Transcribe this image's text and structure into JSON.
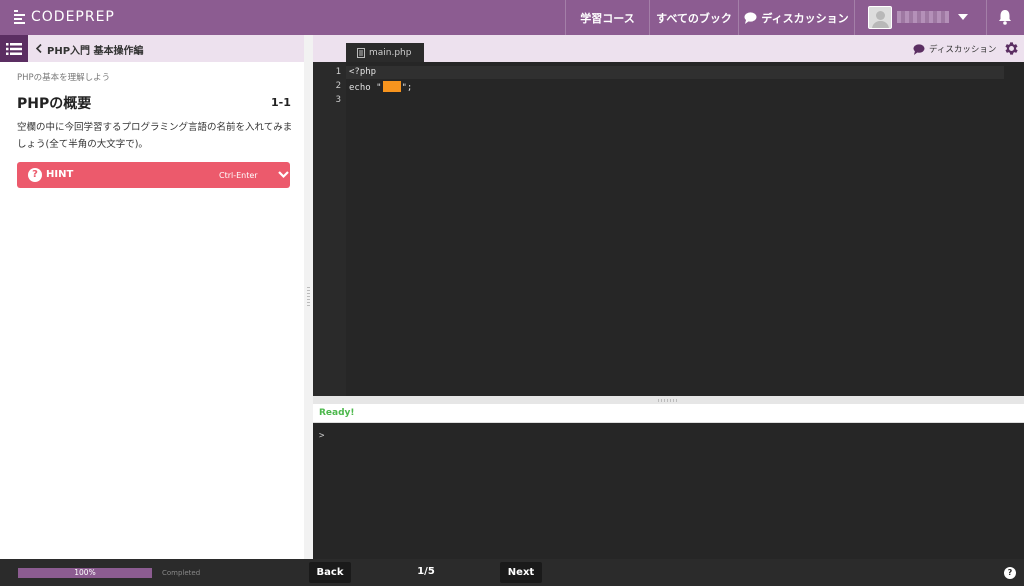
{
  "header": {
    "logo_text": "CODEPREP",
    "nav": {
      "courses": "学習コース",
      "books": "すべてのブック",
      "discussion": "ディスカッション"
    }
  },
  "lesson": {
    "breadcrumb": "PHP入門 基本操作編",
    "section": "PHPの基本を理解しよう",
    "title": "PHPの概要",
    "number": "1-1",
    "instructions": "空欄の中に今回学習するプログラミング言語の名前を入れてみましょう(全て半角の大文字で)。",
    "hint_label": "HINT",
    "hint_shortcut": "Ctrl-Enter"
  },
  "editor": {
    "file_tab": "main.php",
    "discussion_link": "ディスカッション",
    "lines": [
      {
        "num": "1",
        "code": "<?php"
      },
      {
        "num": "2",
        "code_before": "echo \"",
        "code_after": "\";"
      },
      {
        "num": "3",
        "code": ""
      }
    ]
  },
  "console": {
    "status": "Ready!",
    "prompt": ">"
  },
  "footer": {
    "progress_label": "100%",
    "progress_fraction": 1.0,
    "completed_label": "Completed",
    "back": "Back",
    "page": "1/5",
    "next": "Next",
    "help": "?"
  },
  "colors": {
    "brand": "#8c5c91",
    "brand_dark": "#5b2e62",
    "hint": "#ec5a6c",
    "blank": "#f7941e",
    "status_ok": "#4cb84c"
  }
}
